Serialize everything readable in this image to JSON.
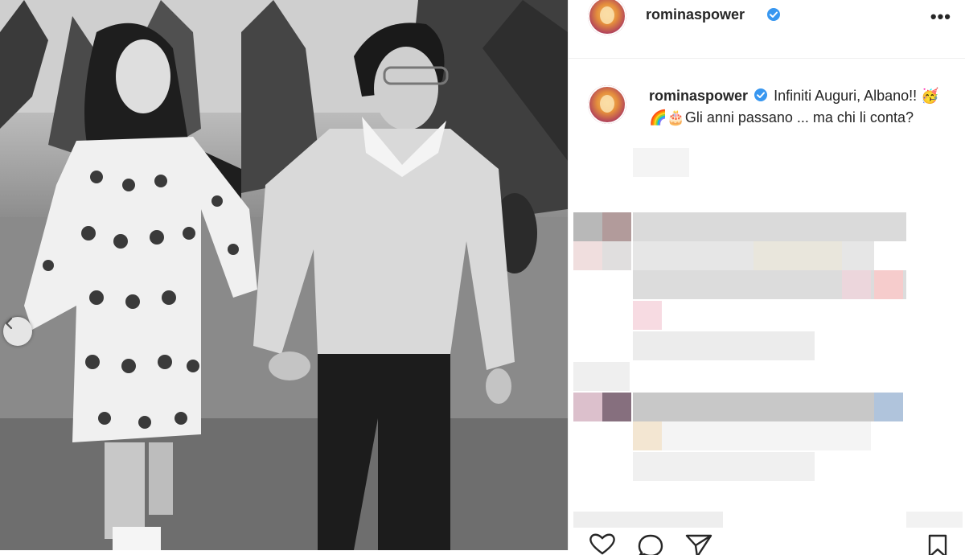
{
  "post": {
    "username": "rominaspower",
    "verified": true,
    "caption_user": "rominaspower",
    "caption_text": "Infiniti Auguri, Albano!! 🥳🌈🎂Gli anni passano ... ma chi li conta?"
  },
  "icons": {
    "more": "more-options-icon",
    "verified": "verified-badge-icon",
    "prev": "chevron-left-icon",
    "like": "heart-icon",
    "comment": "comment-icon",
    "share": "send-icon",
    "save": "bookmark-icon"
  },
  "colors": {
    "verified_blue": "#3897f0",
    "text": "#262626",
    "divider": "#efefef"
  },
  "labels": {
    "more_glyph": "•••"
  }
}
